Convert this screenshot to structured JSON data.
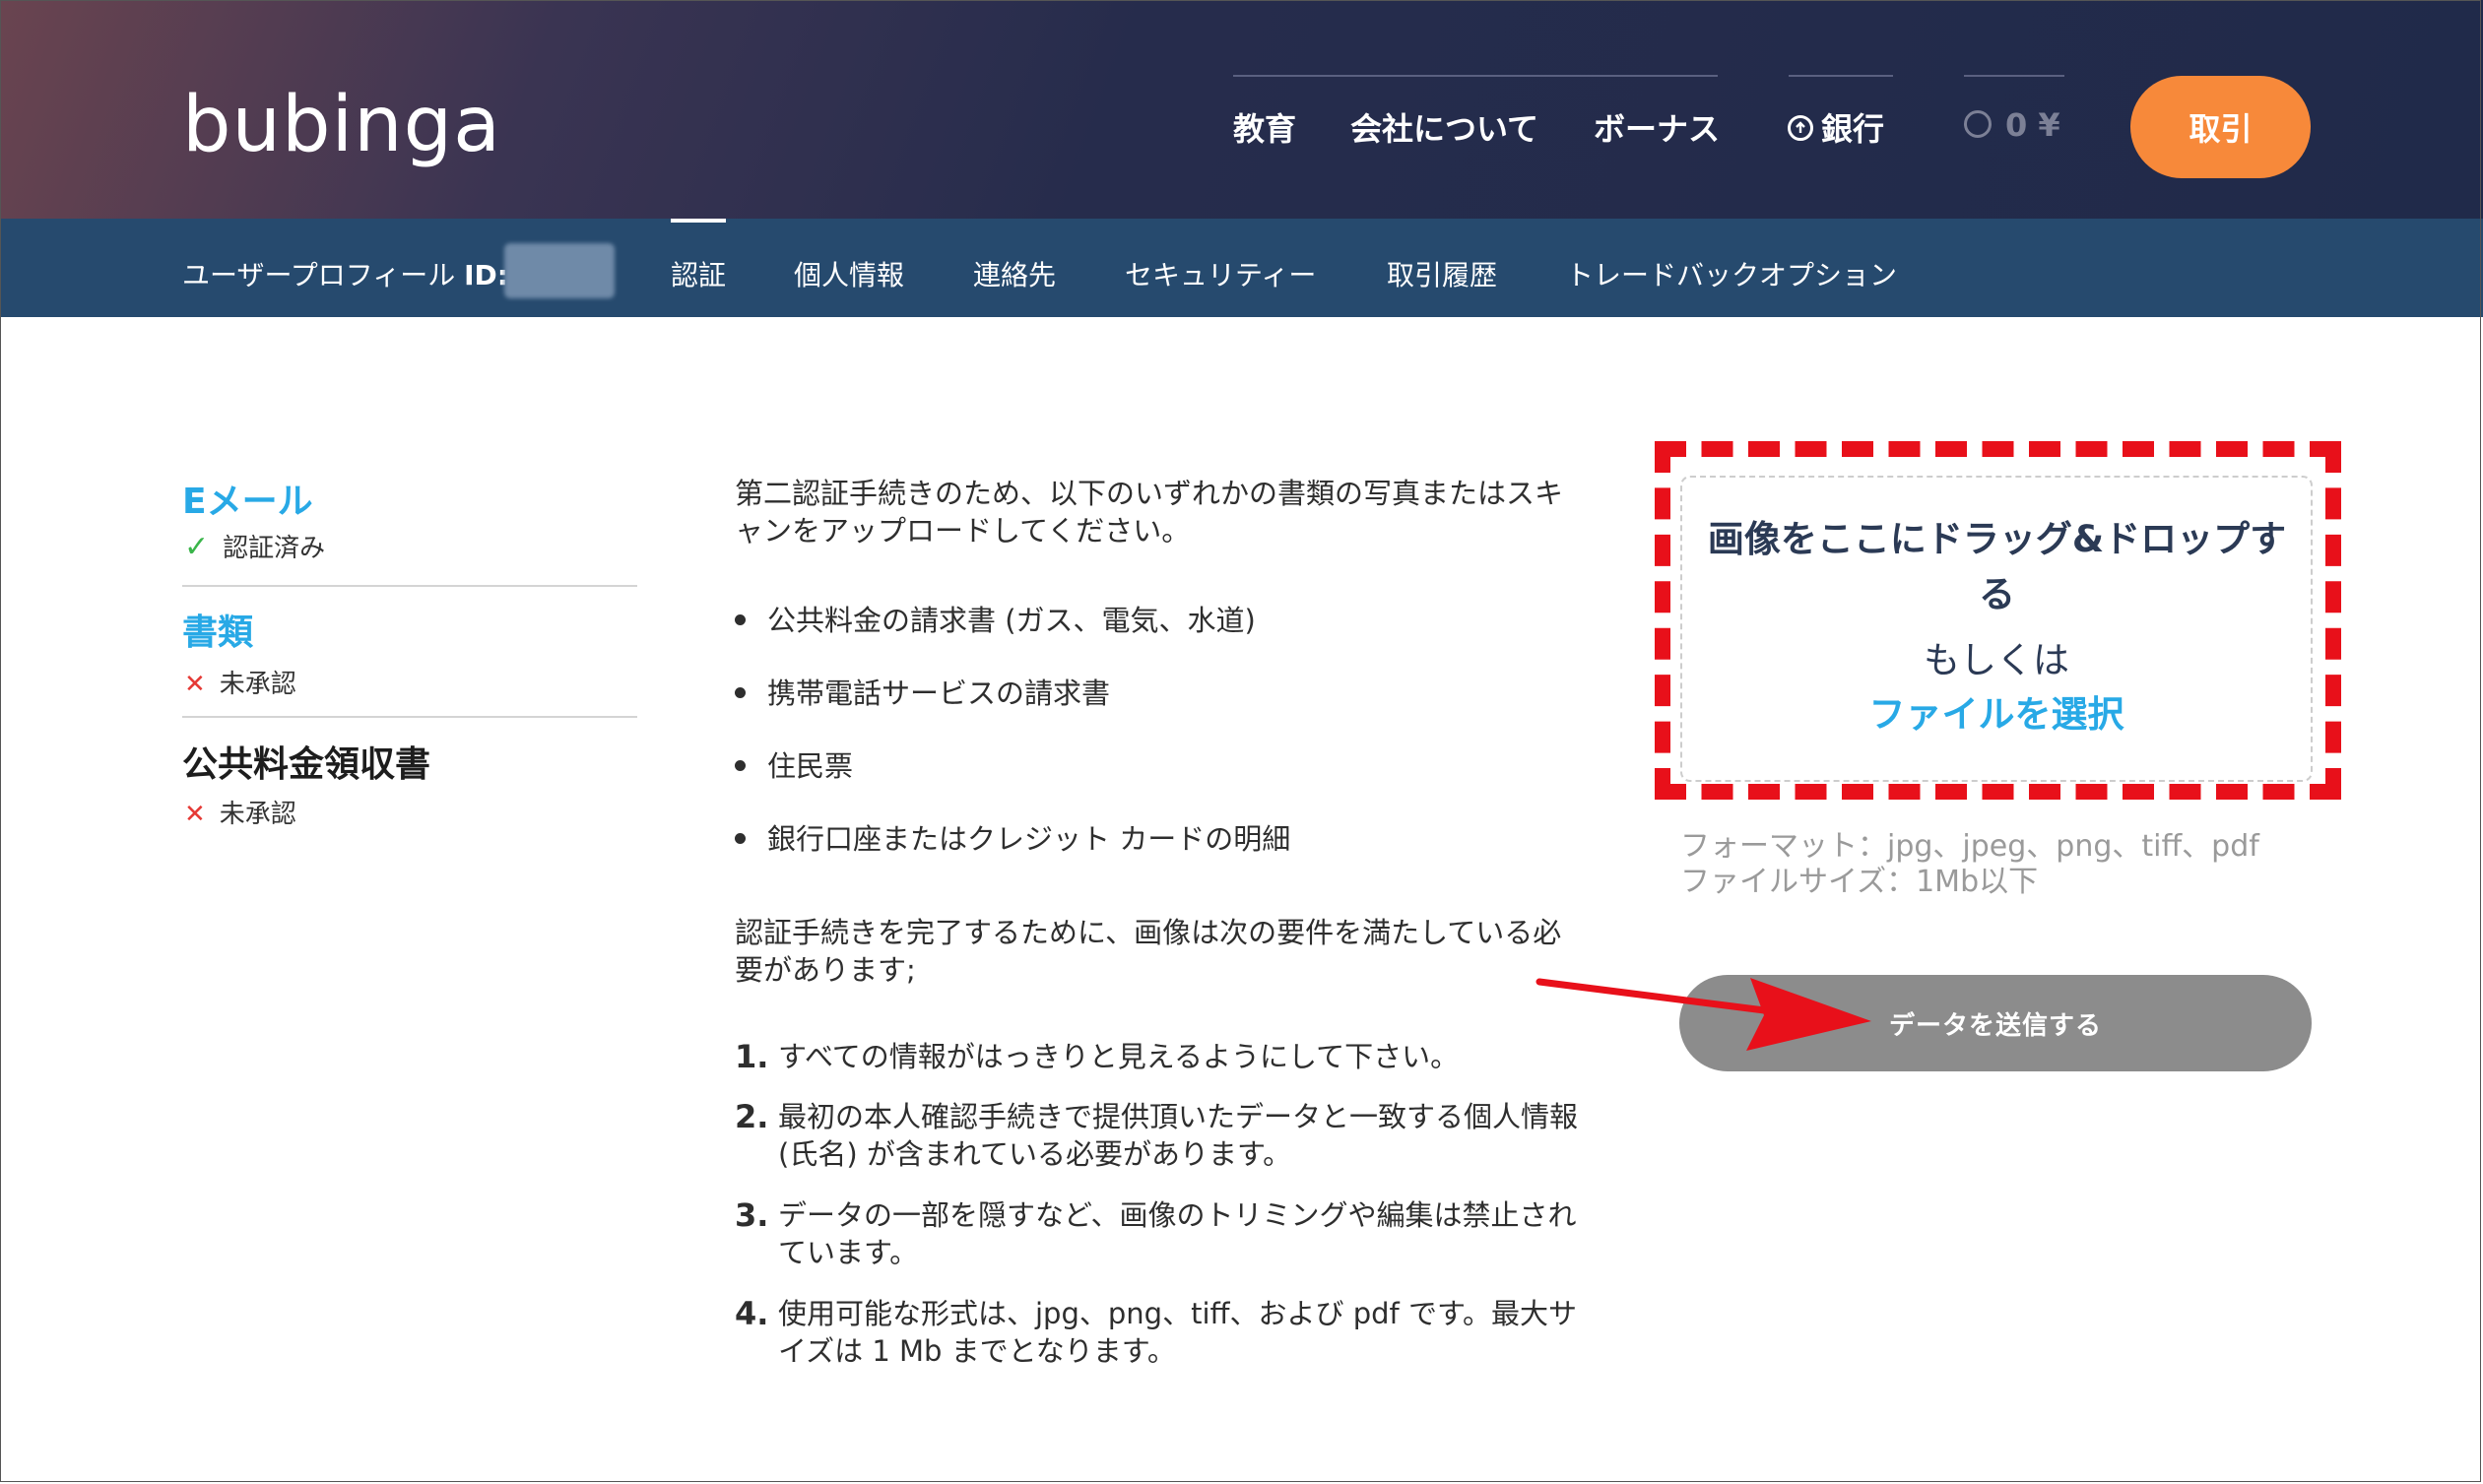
{
  "header": {
    "logo": "bubinga",
    "nav": [
      "教育",
      "会社について",
      "ボーナス"
    ],
    "bank_label": "銀行",
    "balance": "0 ¥",
    "trade_button": "取引"
  },
  "subnav": {
    "profile_label": "ユーザープロフィール",
    "id_label": "ID:",
    "tabs": [
      "認証",
      "個人情報",
      "連絡先",
      "セキュリティー",
      "取引履歴",
      "トレードバックオプション"
    ],
    "active_tab": "認証"
  },
  "sidebar": {
    "items": [
      {
        "title": "Eメール",
        "status": "認証済み",
        "status_icon": "check-icon"
      },
      {
        "title": "書類",
        "status": "未承認",
        "status_icon": "cross-icon"
      },
      {
        "title": "公共料金領収書",
        "status": "未承認",
        "status_icon": "cross-icon"
      }
    ]
  },
  "content": {
    "intro": "第二認証手続きのため、以下のいずれかの書類の写真またはスキャンをアップロードしてください。",
    "documents": [
      "公共料金の請求書 (ガス、電気、水道)",
      "携帯電話サービスの請求書",
      "住民票",
      "銀行口座またはクレジット カードの明細"
    ],
    "requirements_intro": "認証手続きを完了するために、画像は次の要件を満たしている必要があります;",
    "requirements": [
      {
        "n": "1.",
        "text": "すべての情報がはっきりと見えるようにして下さい。"
      },
      {
        "n": "2.",
        "text": "最初の本人確認手続きで提供頂いたデータと一致する個人情報(氏名) が含まれている必要があります。"
      },
      {
        "n": "3.",
        "text": "データの一部を隠すなど、画像のトリミングや編集は禁止されています。"
      },
      {
        "n": "4.",
        "text": "使用可能な形式は、jpg、png、tiff、および pdf です。最大サイズは 1 Mb までとなります。"
      }
    ]
  },
  "upload": {
    "drop_text": "画像をここにドラッグ&ドロップする",
    "or_text": "もしくは",
    "select_link": "ファイルを選択",
    "format_hint": "フォーマット：jpg、jpeg、png、tiff、pdf",
    "size_hint": "ファイルサイズ：1Mb以下",
    "submit_button": "データを送信する"
  },
  "colors": {
    "accent_orange": "#f7893a",
    "link_blue": "#28a9e6",
    "highlight_red": "#e8101a",
    "subnav_bg": "#264a6e"
  }
}
